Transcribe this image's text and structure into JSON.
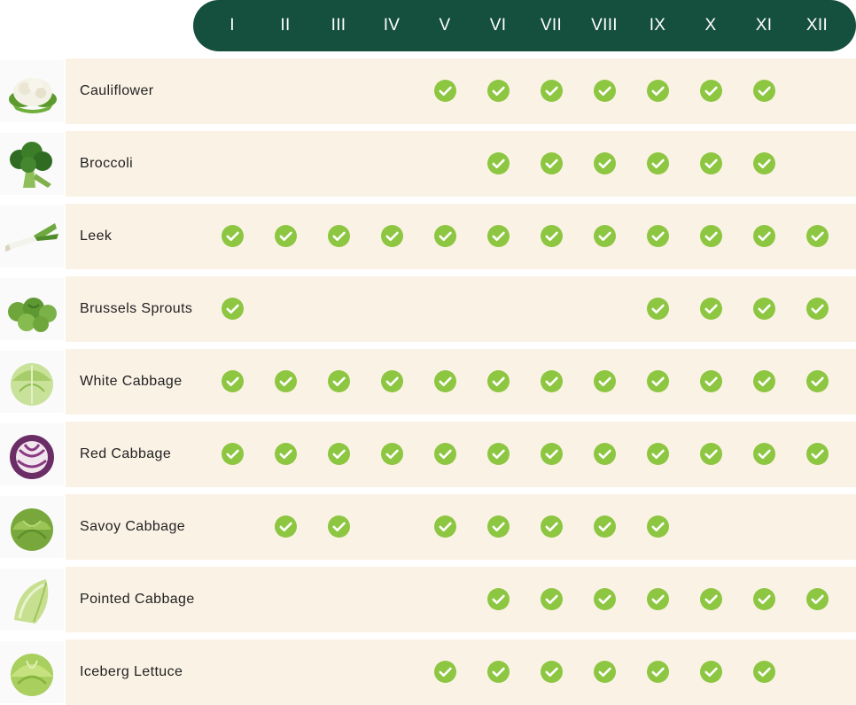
{
  "months": [
    "I",
    "II",
    "III",
    "IV",
    "V",
    "VI",
    "VII",
    "VIII",
    "IX",
    "X",
    "XI",
    "XII"
  ],
  "colors": {
    "header_bg": "#15503f",
    "row_bg": "#fbf2e6",
    "check": "#8dc641"
  },
  "check_icon": "check-circle-icon",
  "vegetables": [
    {
      "name": "Cauliflower",
      "icon": "cauliflower-icon",
      "months": [
        5,
        6,
        7,
        8,
        9,
        10,
        11
      ]
    },
    {
      "name": "Broccoli",
      "icon": "broccoli-icon",
      "months": [
        6,
        7,
        8,
        9,
        10,
        11
      ]
    },
    {
      "name": "Leek",
      "icon": "leek-icon",
      "months": [
        1,
        2,
        3,
        4,
        5,
        6,
        7,
        8,
        9,
        10,
        11,
        12
      ]
    },
    {
      "name": "Brussels Sprouts",
      "icon": "brussels-sprouts-icon",
      "months": [
        1,
        9,
        10,
        11,
        12
      ]
    },
    {
      "name": "White Cabbage",
      "icon": "white-cabbage-icon",
      "months": [
        1,
        2,
        3,
        4,
        5,
        6,
        7,
        8,
        9,
        10,
        11,
        12
      ]
    },
    {
      "name": "Red Cabbage",
      "icon": "red-cabbage-icon",
      "months": [
        1,
        2,
        3,
        4,
        5,
        6,
        7,
        8,
        9,
        10,
        11,
        12
      ]
    },
    {
      "name": "Savoy Cabbage",
      "icon": "savoy-cabbage-icon",
      "months": [
        2,
        3,
        5,
        6,
        7,
        8,
        9
      ]
    },
    {
      "name": "Pointed Cabbage",
      "icon": "pointed-cabbage-icon",
      "months": [
        6,
        7,
        8,
        9,
        10,
        11,
        12
      ]
    },
    {
      "name": "Iceberg Lettuce",
      "icon": "iceberg-lettuce-icon",
      "months": [
        5,
        6,
        7,
        8,
        9,
        10,
        11
      ]
    }
  ]
}
